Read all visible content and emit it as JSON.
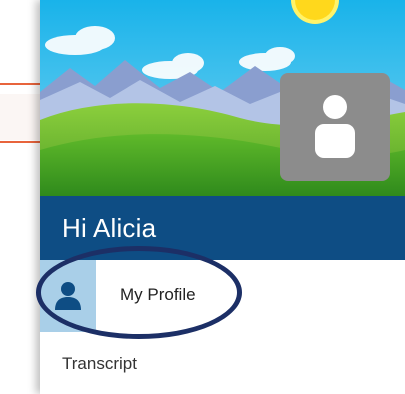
{
  "greeting": "Hi Alicia",
  "nav": {
    "items": [
      {
        "label": "My Profile",
        "icon": "person-icon",
        "selected": true
      },
      {
        "label": "Transcript"
      }
    ]
  },
  "colors": {
    "header_blue": "#0e4d84",
    "selected_icon_bg": "#a9cfe8",
    "annotation_ring": "#1c2f66",
    "accent_line": "#e8643c"
  },
  "icons": {
    "avatar": "user-avatar-placeholder-icon",
    "sun": "sun-icon"
  }
}
